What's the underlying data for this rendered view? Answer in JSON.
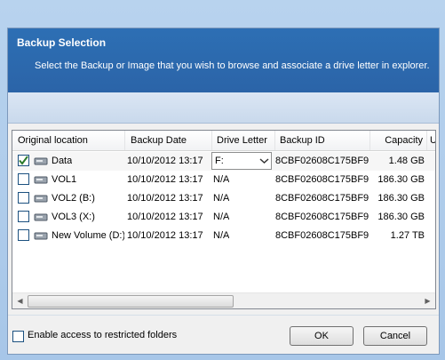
{
  "dialog": {
    "title": "Backup Selection",
    "subtitle": "Select the Backup or Image that you wish to browse and associate a drive letter in explorer."
  },
  "columns": {
    "original_location": "Original location",
    "backup_date": "Backup Date",
    "drive_letter": "Drive Letter",
    "backup_id": "Backup ID",
    "capacity": "Capacity",
    "overflow": "U"
  },
  "rows": [
    {
      "checked": true,
      "name": "Data",
      "date": "10/10/2012 13:17",
      "drive": "F:",
      "id": "8CBF02608C175BF9",
      "capacity": "1.48 GB"
    },
    {
      "checked": false,
      "name": "VOL1",
      "date": "10/10/2012 13:17",
      "drive": "N/A",
      "id": "8CBF02608C175BF9",
      "capacity": "186.30 GB"
    },
    {
      "checked": false,
      "name": "VOL2 (B:)",
      "date": "10/10/2012 13:17",
      "drive": "N/A",
      "id": "8CBF02608C175BF9",
      "capacity": "186.30 GB"
    },
    {
      "checked": false,
      "name": "VOL3 (X:)",
      "date": "10/10/2012 13:17",
      "drive": "N/A",
      "id": "8CBF02608C175BF9",
      "capacity": "186.30 GB"
    },
    {
      "checked": false,
      "name": "New Volume (D:)",
      "date": "10/10/2012 13:17",
      "drive": "N/A",
      "id": "8CBF02608C175BF9",
      "capacity": "1.27 TB"
    }
  ],
  "restricted_label": "Enable access to restricted folders",
  "buttons": {
    "ok": "OK",
    "cancel": "Cancel"
  },
  "icons": {
    "row_icon": "drive-icon",
    "check": "checkmark-icon",
    "combo": "chevron-down-icon"
  },
  "colors": {
    "banner": "#2d6fb4",
    "check_mark": "#2a7a2a"
  }
}
